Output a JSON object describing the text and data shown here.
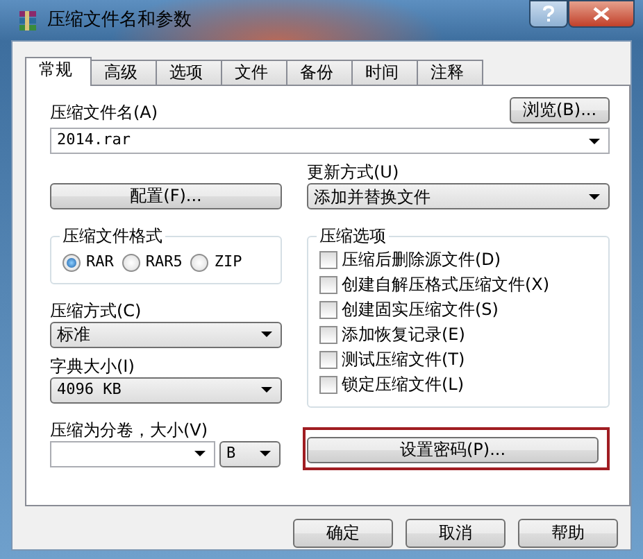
{
  "window": {
    "title": "压缩文件名和参数"
  },
  "tabs": [
    {
      "label": "常规",
      "selected": true
    },
    {
      "label": "高级",
      "selected": false
    },
    {
      "label": "选项",
      "selected": false
    },
    {
      "label": "文件",
      "selected": false
    },
    {
      "label": "备份",
      "selected": false
    },
    {
      "label": "时间",
      "selected": false
    },
    {
      "label": "注释",
      "selected": false
    }
  ],
  "archive_name": {
    "label": "压缩文件名(A)",
    "value": "2014.rar",
    "browse_button": "浏览(B)..."
  },
  "profiles_button": "配置(F)...",
  "update_mode": {
    "label": "更新方式(U)",
    "value": "添加并替换文件"
  },
  "archive_format": {
    "title": "压缩文件格式",
    "options": [
      {
        "label": "RAR",
        "selected": true
      },
      {
        "label": "RAR5",
        "selected": false
      },
      {
        "label": "ZIP",
        "selected": false
      }
    ]
  },
  "compression_method": {
    "label": "压缩方式(C)",
    "value": "标准"
  },
  "dictionary_size": {
    "label": "字典大小(I)",
    "value": "4096 KB"
  },
  "split_volumes": {
    "label": "压缩为分卷，大小(V)",
    "unit": "B"
  },
  "archiving_options": {
    "title": "压缩选项",
    "options": [
      {
        "label": "压缩后删除源文件(D)",
        "checked": false
      },
      {
        "label": "创建自解压格式压缩文件(X)",
        "checked": false
      },
      {
        "label": "创建固实压缩文件(S)",
        "checked": false
      },
      {
        "label": "添加恢复记录(E)",
        "checked": false
      },
      {
        "label": "测试压缩文件(T)",
        "checked": false
      },
      {
        "label": "锁定压缩文件(L)",
        "checked": false
      }
    ]
  },
  "password_button": {
    "label": "设置密码(P)...",
    "highlighted": true
  },
  "buttons": [
    {
      "label": "确定"
    },
    {
      "label": "取消"
    },
    {
      "label": "帮助"
    }
  ]
}
